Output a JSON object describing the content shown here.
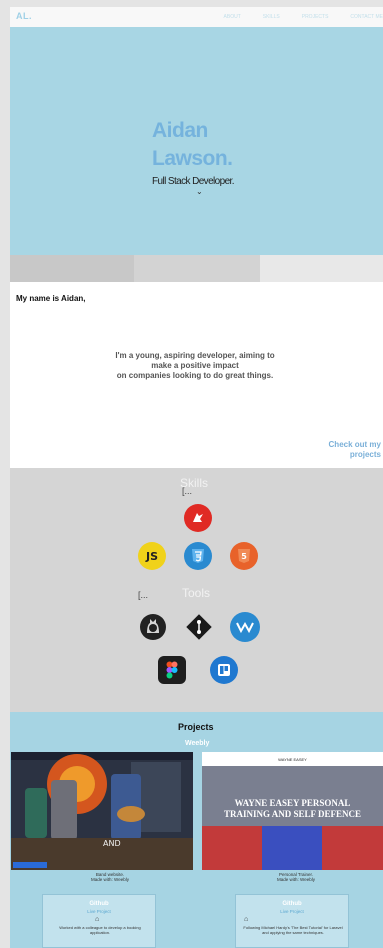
{
  "nav": {
    "logo": "AL.",
    "links": [
      "ABOUT",
      "SKILLS",
      "PROJECTS",
      "CONTACT ME"
    ]
  },
  "hero": {
    "first_name": "Aidan",
    "last_name": "Lawson.",
    "role": "Full Stack Developer."
  },
  "about": {
    "greeting": "My name is Aidan,",
    "bio_line1": "I'm a young, aspiring developer, aiming to",
    "bio_line2": "make a positive impact",
    "bio_line3": "on companies looking to do great things.",
    "cta_line1": "Check out my",
    "cta_line2": "projects"
  },
  "skills": {
    "heading": "Skills",
    "dots_skills": "[...",
    "tools_heading": "Tools",
    "dots_tools": "[...",
    "skill_icons": [
      "laravel-icon",
      "javascript-icon",
      "css3-icon",
      "html5-icon"
    ],
    "tool_icons": [
      "github-icon",
      "git-icon",
      "webflow-icon",
      "figma-icon",
      "trello-icon"
    ],
    "js_label": "JS"
  },
  "projects": {
    "title": "Projects",
    "tag": "Weebly",
    "card1_caption_line1": "Band website.",
    "card1_caption_line2": "Made with: Weebly",
    "card1_overlay": "AND",
    "card2_header": "WAYNE EASEY",
    "card2_headline_line1": "WAYNE EASEY PERSONAL",
    "card2_headline_line2": "TRAINING AND SELF DEFENCE",
    "card2_caption_line1": "Personal Trainer.",
    "card2_caption_line2": "Made with: Weebly",
    "info1_title": "Github",
    "info1_link": "Live Project",
    "info1_body": "Worked with a colleague to develop a booking application.",
    "info2_title": "Github",
    "info2_link": "Live Project",
    "info2_body": "Following Michael Hardy's 'The Best Tutorial' for Laravel and applying the same techniques."
  },
  "colors": {
    "accent": "#75b3dd",
    "hero_bg": "#a8d6e4",
    "skills_bg": "#d5d5d5",
    "projects_bg": "#a6d4e3"
  }
}
